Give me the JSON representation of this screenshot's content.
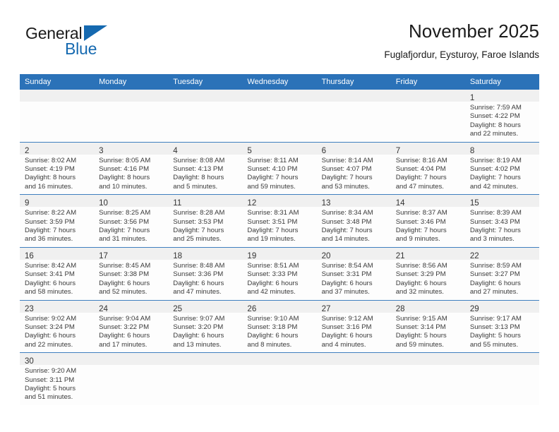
{
  "logo": {
    "word1": "General",
    "word2": "Blue",
    "triangle_color": "#1569b0",
    "icon": "triangle-icon"
  },
  "header": {
    "title": "November 2025",
    "subtitle": "Fuglafjordur, Eysturoy, Faroe Islands"
  },
  "colors": {
    "header_blue": "#2b72b8",
    "row_divider": "#3f7fbf",
    "daynum_band": "#f0f0f0",
    "logo_blue": "#1569b0"
  },
  "weekday_headers": [
    "Sunday",
    "Monday",
    "Tuesday",
    "Wednesday",
    "Thursday",
    "Friday",
    "Saturday"
  ],
  "weeks": [
    [
      {
        "day": ""
      },
      {
        "day": ""
      },
      {
        "day": ""
      },
      {
        "day": ""
      },
      {
        "day": ""
      },
      {
        "day": ""
      },
      {
        "day": "1",
        "sunrise": "Sunrise: 7:59 AM",
        "sunset": "Sunset: 4:22 PM",
        "daylight1": "Daylight: 8 hours",
        "daylight2": "and 22 minutes."
      }
    ],
    [
      {
        "day": "2",
        "sunrise": "Sunrise: 8:02 AM",
        "sunset": "Sunset: 4:19 PM",
        "daylight1": "Daylight: 8 hours",
        "daylight2": "and 16 minutes."
      },
      {
        "day": "3",
        "sunrise": "Sunrise: 8:05 AM",
        "sunset": "Sunset: 4:16 PM",
        "daylight1": "Daylight: 8 hours",
        "daylight2": "and 10 minutes."
      },
      {
        "day": "4",
        "sunrise": "Sunrise: 8:08 AM",
        "sunset": "Sunset: 4:13 PM",
        "daylight1": "Daylight: 8 hours",
        "daylight2": "and 5 minutes."
      },
      {
        "day": "5",
        "sunrise": "Sunrise: 8:11 AM",
        "sunset": "Sunset: 4:10 PM",
        "daylight1": "Daylight: 7 hours",
        "daylight2": "and 59 minutes."
      },
      {
        "day": "6",
        "sunrise": "Sunrise: 8:14 AM",
        "sunset": "Sunset: 4:07 PM",
        "daylight1": "Daylight: 7 hours",
        "daylight2": "and 53 minutes."
      },
      {
        "day": "7",
        "sunrise": "Sunrise: 8:16 AM",
        "sunset": "Sunset: 4:04 PM",
        "daylight1": "Daylight: 7 hours",
        "daylight2": "and 47 minutes."
      },
      {
        "day": "8",
        "sunrise": "Sunrise: 8:19 AM",
        "sunset": "Sunset: 4:02 PM",
        "daylight1": "Daylight: 7 hours",
        "daylight2": "and 42 minutes."
      }
    ],
    [
      {
        "day": "9",
        "sunrise": "Sunrise: 8:22 AM",
        "sunset": "Sunset: 3:59 PM",
        "daylight1": "Daylight: 7 hours",
        "daylight2": "and 36 minutes."
      },
      {
        "day": "10",
        "sunrise": "Sunrise: 8:25 AM",
        "sunset": "Sunset: 3:56 PM",
        "daylight1": "Daylight: 7 hours",
        "daylight2": "and 31 minutes."
      },
      {
        "day": "11",
        "sunrise": "Sunrise: 8:28 AM",
        "sunset": "Sunset: 3:53 PM",
        "daylight1": "Daylight: 7 hours",
        "daylight2": "and 25 minutes."
      },
      {
        "day": "12",
        "sunrise": "Sunrise: 8:31 AM",
        "sunset": "Sunset: 3:51 PM",
        "daylight1": "Daylight: 7 hours",
        "daylight2": "and 19 minutes."
      },
      {
        "day": "13",
        "sunrise": "Sunrise: 8:34 AM",
        "sunset": "Sunset: 3:48 PM",
        "daylight1": "Daylight: 7 hours",
        "daylight2": "and 14 minutes."
      },
      {
        "day": "14",
        "sunrise": "Sunrise: 8:37 AM",
        "sunset": "Sunset: 3:46 PM",
        "daylight1": "Daylight: 7 hours",
        "daylight2": "and 9 minutes."
      },
      {
        "day": "15",
        "sunrise": "Sunrise: 8:39 AM",
        "sunset": "Sunset: 3:43 PM",
        "daylight1": "Daylight: 7 hours",
        "daylight2": "and 3 minutes."
      }
    ],
    [
      {
        "day": "16",
        "sunrise": "Sunrise: 8:42 AM",
        "sunset": "Sunset: 3:41 PM",
        "daylight1": "Daylight: 6 hours",
        "daylight2": "and 58 minutes."
      },
      {
        "day": "17",
        "sunrise": "Sunrise: 8:45 AM",
        "sunset": "Sunset: 3:38 PM",
        "daylight1": "Daylight: 6 hours",
        "daylight2": "and 52 minutes."
      },
      {
        "day": "18",
        "sunrise": "Sunrise: 8:48 AM",
        "sunset": "Sunset: 3:36 PM",
        "daylight1": "Daylight: 6 hours",
        "daylight2": "and 47 minutes."
      },
      {
        "day": "19",
        "sunrise": "Sunrise: 8:51 AM",
        "sunset": "Sunset: 3:33 PM",
        "daylight1": "Daylight: 6 hours",
        "daylight2": "and 42 minutes."
      },
      {
        "day": "20",
        "sunrise": "Sunrise: 8:54 AM",
        "sunset": "Sunset: 3:31 PM",
        "daylight1": "Daylight: 6 hours",
        "daylight2": "and 37 minutes."
      },
      {
        "day": "21",
        "sunrise": "Sunrise: 8:56 AM",
        "sunset": "Sunset: 3:29 PM",
        "daylight1": "Daylight: 6 hours",
        "daylight2": "and 32 minutes."
      },
      {
        "day": "22",
        "sunrise": "Sunrise: 8:59 AM",
        "sunset": "Sunset: 3:27 PM",
        "daylight1": "Daylight: 6 hours",
        "daylight2": "and 27 minutes."
      }
    ],
    [
      {
        "day": "23",
        "sunrise": "Sunrise: 9:02 AM",
        "sunset": "Sunset: 3:24 PM",
        "daylight1": "Daylight: 6 hours",
        "daylight2": "and 22 minutes."
      },
      {
        "day": "24",
        "sunrise": "Sunrise: 9:04 AM",
        "sunset": "Sunset: 3:22 PM",
        "daylight1": "Daylight: 6 hours",
        "daylight2": "and 17 minutes."
      },
      {
        "day": "25",
        "sunrise": "Sunrise: 9:07 AM",
        "sunset": "Sunset: 3:20 PM",
        "daylight1": "Daylight: 6 hours",
        "daylight2": "and 13 minutes."
      },
      {
        "day": "26",
        "sunrise": "Sunrise: 9:10 AM",
        "sunset": "Sunset: 3:18 PM",
        "daylight1": "Daylight: 6 hours",
        "daylight2": "and 8 minutes."
      },
      {
        "day": "27",
        "sunrise": "Sunrise: 9:12 AM",
        "sunset": "Sunset: 3:16 PM",
        "daylight1": "Daylight: 6 hours",
        "daylight2": "and 4 minutes."
      },
      {
        "day": "28",
        "sunrise": "Sunrise: 9:15 AM",
        "sunset": "Sunset: 3:14 PM",
        "daylight1": "Daylight: 5 hours",
        "daylight2": "and 59 minutes."
      },
      {
        "day": "29",
        "sunrise": "Sunrise: 9:17 AM",
        "sunset": "Sunset: 3:13 PM",
        "daylight1": "Daylight: 5 hours",
        "daylight2": "and 55 minutes."
      }
    ],
    [
      {
        "day": "30",
        "sunrise": "Sunrise: 9:20 AM",
        "sunset": "Sunset: 3:11 PM",
        "daylight1": "Daylight: 5 hours",
        "daylight2": "and 51 minutes."
      },
      {
        "day": ""
      },
      {
        "day": ""
      },
      {
        "day": ""
      },
      {
        "day": ""
      },
      {
        "day": ""
      },
      {
        "day": ""
      }
    ]
  ]
}
